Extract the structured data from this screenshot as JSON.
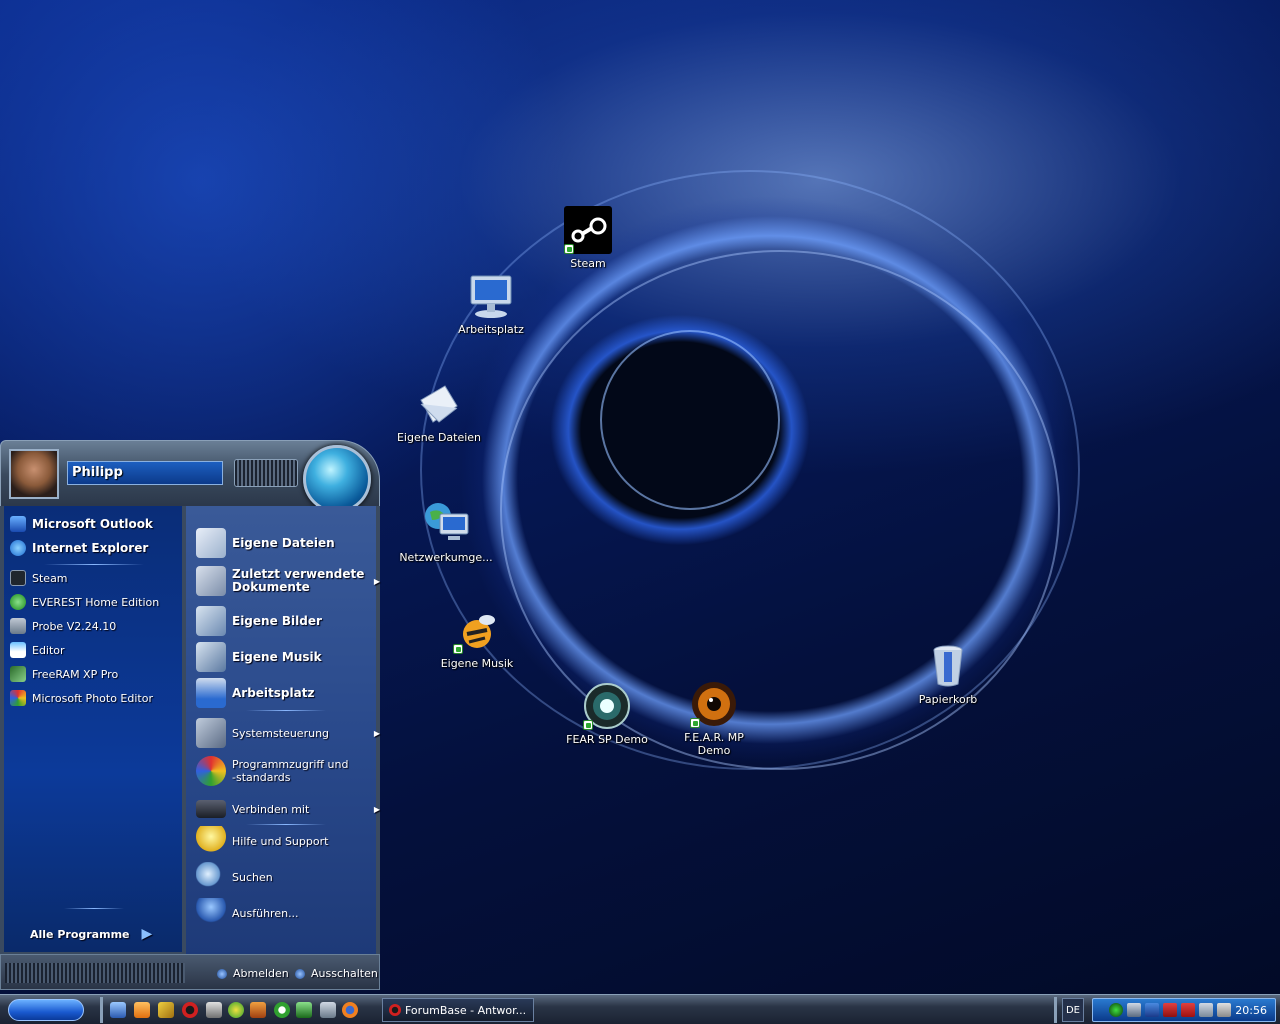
{
  "desktop": {
    "icons": [
      {
        "label": "Steam",
        "icon": "steam-icon"
      },
      {
        "label": "Arbeitsplatz",
        "icon": "computer-icon"
      },
      {
        "label": "Eigene Dateien",
        "icon": "documents-folder-icon"
      },
      {
        "label": "Netzwerkumge...",
        "icon": "network-icon"
      },
      {
        "label": "Eigene Musik",
        "icon": "music-icon"
      },
      {
        "label": "FEAR SP Demo",
        "icon": "fear-sp-icon"
      },
      {
        "label": "F.E.A.R. MP",
        "label2": "Demo",
        "icon": "fear-mp-icon"
      },
      {
        "label": "Papierkorb",
        "icon": "recycle-bin-icon"
      }
    ]
  },
  "start_menu": {
    "user_name": "Philipp",
    "pinned": [
      {
        "label": "Microsoft Outlook",
        "icon": "outlook-icon"
      },
      {
        "label": "Internet Explorer",
        "icon": "ie-icon"
      }
    ],
    "recent": [
      {
        "label": "Steam",
        "icon": "steam-icon"
      },
      {
        "label": "EVEREST Home Edition",
        "icon": "everest-icon"
      },
      {
        "label": "Probe V2.24.10",
        "icon": "probe-icon"
      },
      {
        "label": "Editor",
        "icon": "notepad-icon"
      },
      {
        "label": "FreeRAM XP Pro",
        "icon": "ram-icon"
      },
      {
        "label": "Microsoft Photo Editor",
        "icon": "photo-editor-icon"
      }
    ],
    "all_programs": "Alle Programme",
    "places": [
      {
        "label": "Eigene Dateien",
        "icon": "documents-icon"
      },
      {
        "label": "Zuletzt verwendete",
        "label2": "Dokumente",
        "icon": "recent-docs-icon"
      },
      {
        "label": "Eigene Bilder",
        "icon": "pictures-icon"
      },
      {
        "label": "Eigene Musik",
        "icon": "music-folder-icon"
      },
      {
        "label": "Arbeitsplatz",
        "icon": "computer-icon"
      }
    ],
    "system": [
      {
        "label": "Systemsteuerung",
        "icon": "control-panel-icon"
      },
      {
        "label": "Programmzugriff und",
        "label2": "-standards",
        "icon": "program-access-icon"
      },
      {
        "label": "Verbinden mit",
        "icon": "connect-icon"
      }
    ],
    "help": [
      {
        "label": "Hilfe und Support",
        "icon": "help-icon"
      },
      {
        "label": "Suchen",
        "icon": "search-icon"
      },
      {
        "label": "Ausführen...",
        "icon": "run-icon"
      }
    ],
    "logoff": "Abmelden",
    "shutdown": "Ausschalten"
  },
  "taskbar": {
    "task_title": "ForumBase - Antwor...",
    "language": "DE",
    "clock": "20:56"
  }
}
